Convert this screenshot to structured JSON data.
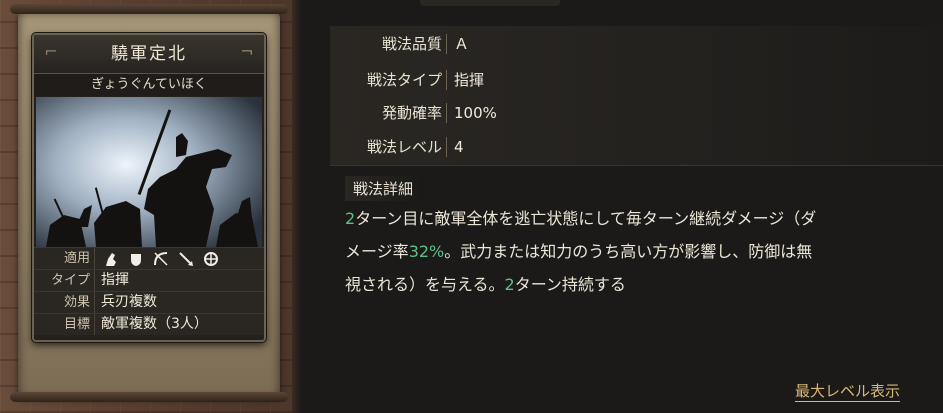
{
  "card": {
    "title": "驍軍定北",
    "reading": "ぎょうぐんていほく",
    "rows": [
      {
        "label": "適用",
        "value": ""
      },
      {
        "label": "タイプ",
        "value": "指揮"
      },
      {
        "label": "効果",
        "value": "兵刃複数"
      },
      {
        "label": "目標",
        "value": "敵軍複数（3人）"
      }
    ],
    "unit_icons": [
      "cavalry-icon",
      "shield-icon",
      "bow-icon",
      "spear-icon",
      "chariot-icon"
    ]
  },
  "fields": [
    {
      "label": "戦法品質",
      "value": "Ａ"
    },
    {
      "label": "戦法タイプ",
      "value": "指揮"
    },
    {
      "label": "発動確率",
      "value": "100%"
    },
    {
      "label": "戦法レベル",
      "value": "4"
    }
  ],
  "detail": {
    "title": "戦法詳細",
    "line1_num": "2",
    "line1_text": "ターン目に敵軍全体を逃亡状態にして毎ターン継続ダメージ（ダ",
    "line2_text_a": "メージ率",
    "line2_num": "32%",
    "line2_text_b": "。武力または知力のうち高い方が影響し、防御は無",
    "line3_text_a": "視される）を与える。",
    "line3_num": "2",
    "line3_text_b": "ターン持続する"
  },
  "max_level_link": "最大レベル表示",
  "colors": {
    "highlight_number": "#5fc08a",
    "link": "#d9b774"
  }
}
